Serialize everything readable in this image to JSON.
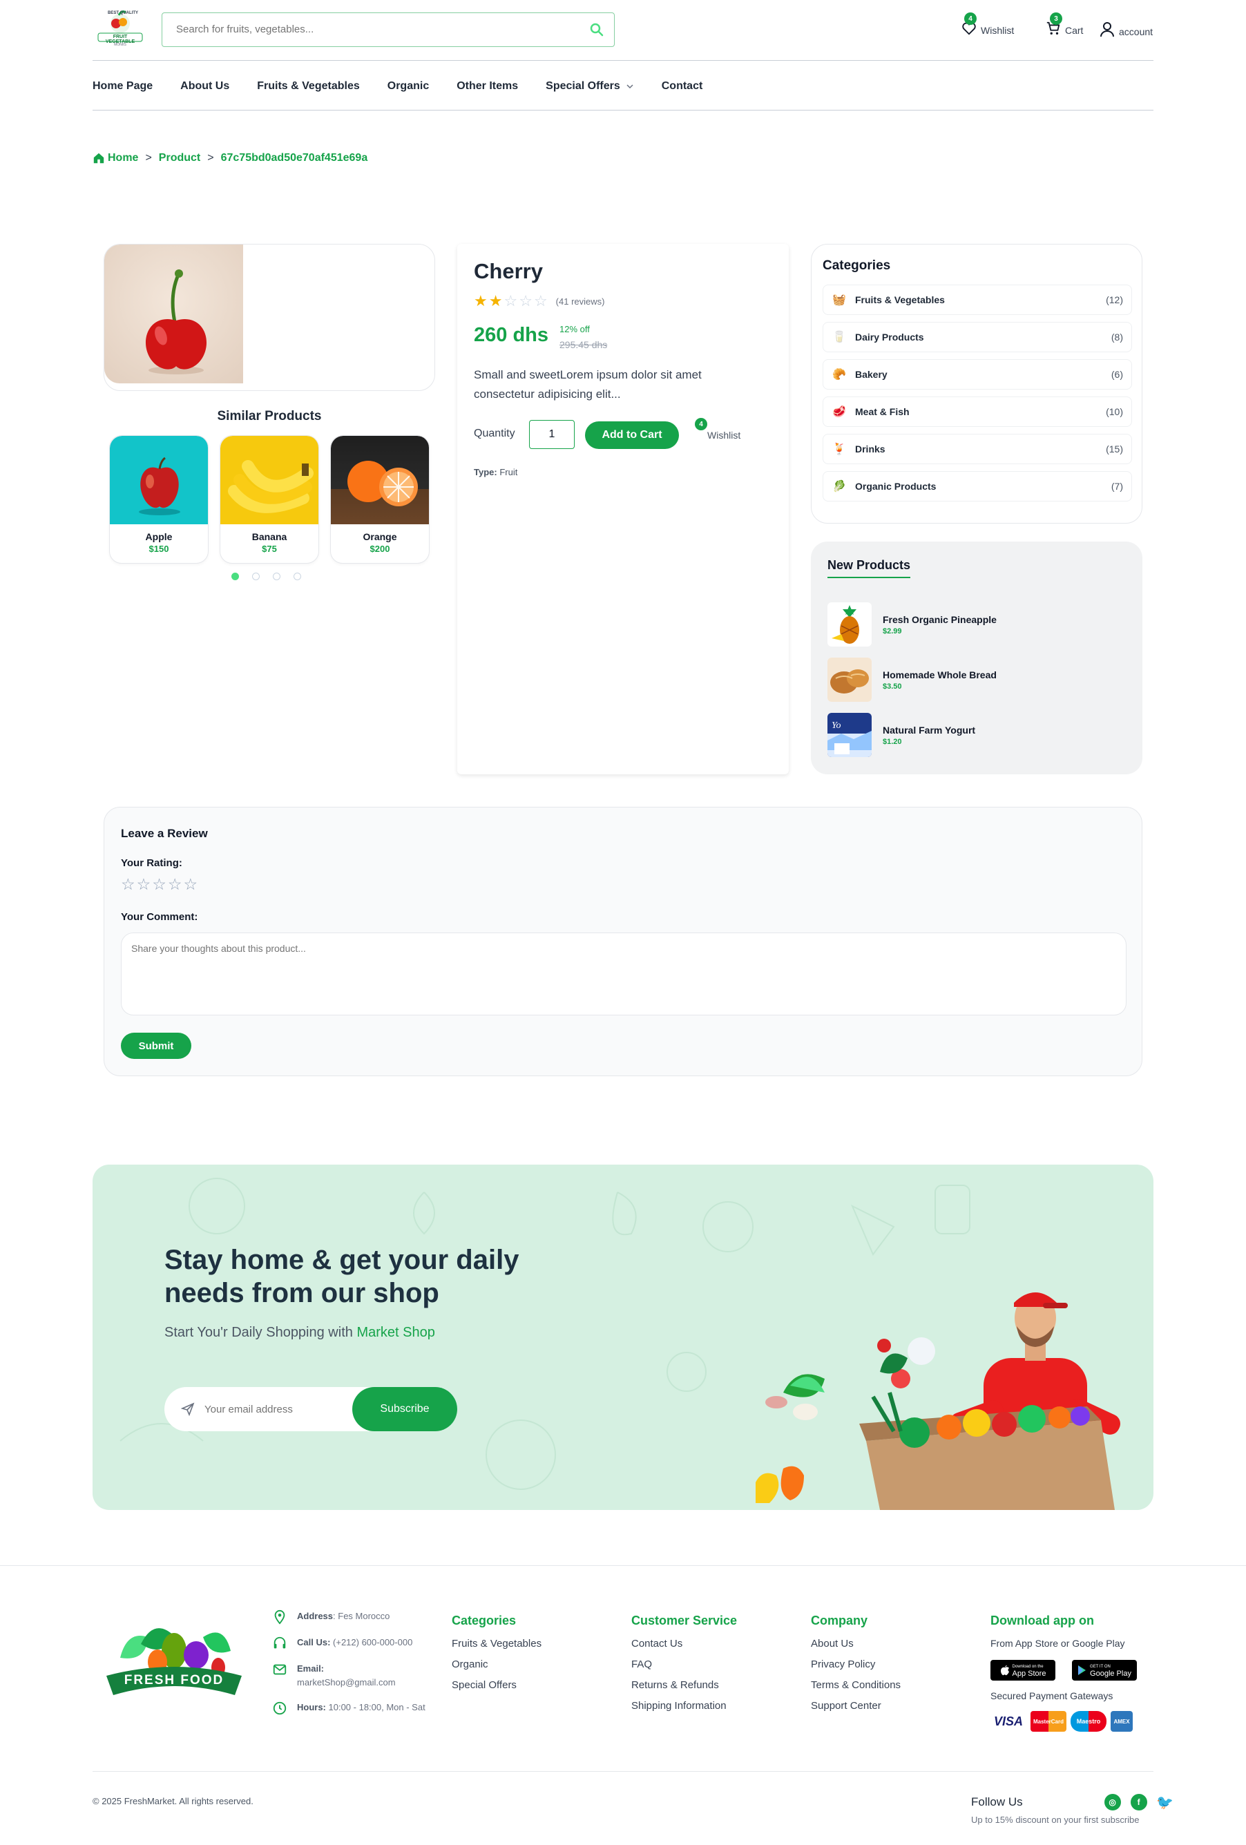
{
  "header": {
    "logo_top_text": "BEST QUALITY",
    "logo_main_text": "FRUIT VEGETABLE",
    "logo_sub_text": "MONIIS",
    "search_placeholder": "Search for fruits, vegetables...",
    "wishlist_label": "Wishlist",
    "wishlist_count": "4",
    "cart_label": "Cart",
    "cart_count": "3",
    "account_label": "account"
  },
  "nav": {
    "items": [
      "Home Page",
      "About Us",
      "Fruits & Vegetables",
      "Organic",
      "Other Items",
      "Special Offers",
      "Contact"
    ]
  },
  "breadcrumb": {
    "home": "Home",
    "sep": ">",
    "product": "Product",
    "id": "67c75bd0ad50e70af451e69a"
  },
  "similar": {
    "title": "Similar Products",
    "items": [
      {
        "name": "Apple",
        "price": "$150"
      },
      {
        "name": "Banana",
        "price": "$75"
      },
      {
        "name": "Orange",
        "price": "$200"
      }
    ],
    "active_dot": 0
  },
  "product": {
    "title": "Cherry",
    "rating": 2,
    "rating_max": 5,
    "reviews": "(41 reviews)",
    "price": "260 dhs",
    "discount": "12% off",
    "old_price": "295.45 dhs",
    "description": "Small and sweetLorem ipsum dolor sit amet consectetur adipisicing elit...",
    "quantity_label": "Quantity",
    "quantity_value": "1",
    "add_to_cart": "Add to Cart",
    "wishlist_label": "Wishlist",
    "wishlist_count": "4",
    "type_label": "Type:",
    "type_value": "Fruit"
  },
  "categories": {
    "title": "Categories",
    "items": [
      {
        "name": "Fruits & Vegetables",
        "count": "(12)",
        "icon": "basket-icon"
      },
      {
        "name": "Dairy Products",
        "count": "(8)",
        "icon": "milk-icon"
      },
      {
        "name": "Bakery",
        "count": "(6)",
        "icon": "bread-icon"
      },
      {
        "name": "Meat & Fish",
        "count": "(10)",
        "icon": "meat-icon"
      },
      {
        "name": "Drinks",
        "count": "(15)",
        "icon": "drink-icon"
      },
      {
        "name": "Organic Products",
        "count": "(7)",
        "icon": "leaf-icon"
      }
    ]
  },
  "new_products": {
    "title": "New Products",
    "items": [
      {
        "name": "Fresh Organic Pineapple",
        "price": "$2.99"
      },
      {
        "name": "Homemade Whole Bread",
        "price": "$3.50"
      },
      {
        "name": "Natural Farm Yogurt",
        "price": "$1.20"
      }
    ]
  },
  "review": {
    "title": "Leave a Review",
    "rating_label": "Your Rating:",
    "comment_label": "Your Comment:",
    "comment_placeholder": "Share your thoughts about this product...",
    "submit": "Submit"
  },
  "banner": {
    "headline": "Stay home & get your daily needs from our shop",
    "sub_prefix": "Start You'r Daily Shopping with ",
    "sub_highlight": "Market Shop",
    "email_placeholder": "Your email address",
    "subscribe": "Subscribe"
  },
  "footer": {
    "logo_text": "FRESH FOOD",
    "address_label": "Address",
    "address": ": Fes Morocco",
    "call_label": "Call Us:",
    "call": " (+212) 600-000-000",
    "email_label": "Email:",
    "email": "marketShop@gmail.com",
    "hours_label": "Hours:",
    "hours": " 10:00 - 18:00, Mon - Sat",
    "categories": {
      "title": "Categories",
      "links": [
        "Fruits & Vegetables",
        "Organic",
        "Special Offers"
      ]
    },
    "service": {
      "title": "Customer Service",
      "links": [
        "Contact Us",
        "FAQ",
        "Returns & Refunds",
        "Shipping Information"
      ]
    },
    "company": {
      "title": "Company",
      "links": [
        "About Us",
        "Privacy Policy",
        "Terms & Conditions",
        "Support Center"
      ]
    },
    "app": {
      "title": "Download app on",
      "sub": "From App Store or Google Play",
      "app_store_small": "Download on the",
      "app_store": "App Store",
      "google_small": "GET IT ON",
      "google": "Google Play",
      "payment_label": "Secured Payment Gateways",
      "payments": [
        "VISA",
        "MasterCard",
        "Maestro",
        "AMEX"
      ]
    },
    "copyright": "© 2025 FreshMarket. All rights reserved.",
    "follow": "Follow Us",
    "follow_sub": "Up to 15% discount on your first subscribe"
  },
  "colors": {
    "accent": "#16a34a",
    "banner_bg": "#d5f0e1",
    "star": "#f5b301"
  }
}
